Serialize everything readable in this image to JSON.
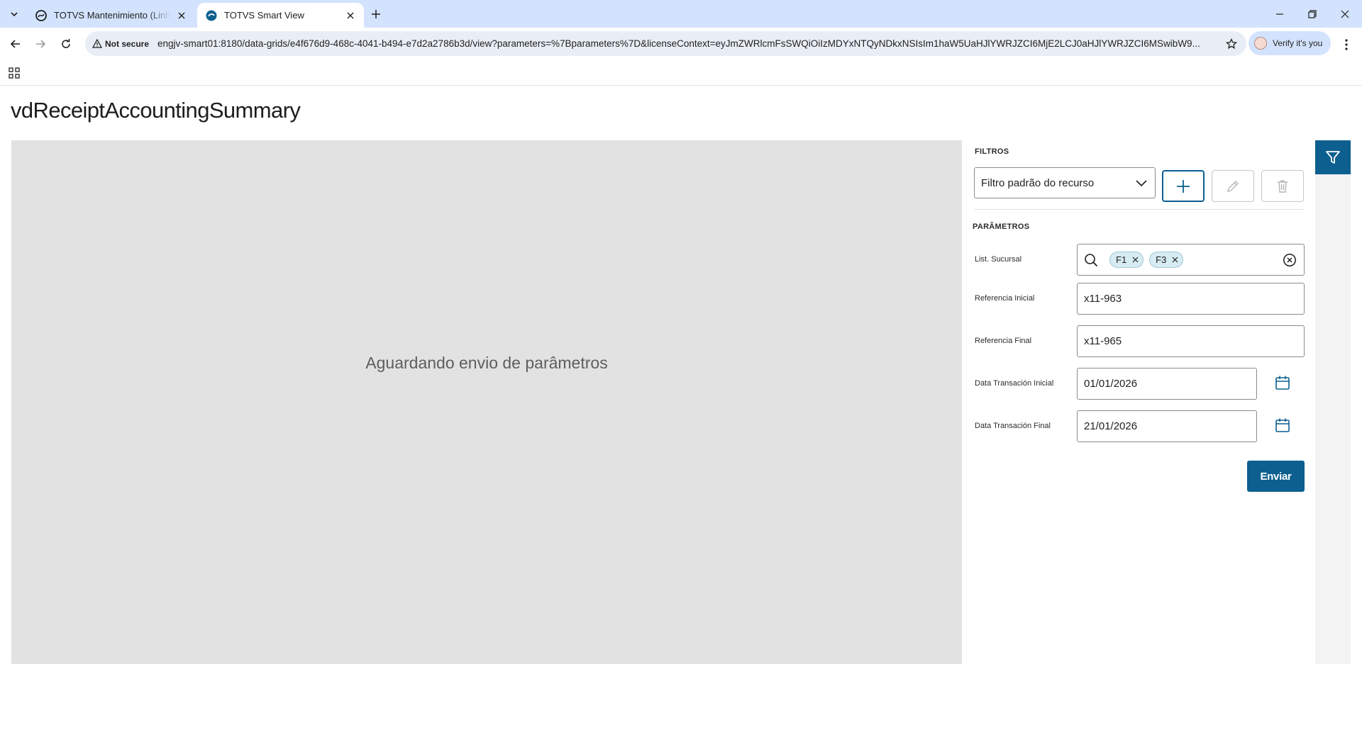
{
  "browser": {
    "tabs": [
      {
        "title": "TOTVS Mantenimiento (Linha D",
        "active": false
      },
      {
        "title": "TOTVS Smart View",
        "active": true
      }
    ],
    "address": {
      "security_label": "Not secure",
      "url": "engjv-smart01:8180/data-grids/e4f676d9-468c-4041-b494-e7d2a2786b3d/view?parameters=%7Bparameters%7D&licenseContext=eyJmZWRlcmFsSWQiOiIzMDYxNTQyNDkxNSIsIm1haW5UaHJlYWRJZCI6MjE2LCJ0aHJlYWRJZCI6MSwibW9..."
    },
    "profile_label": "Verify it's you"
  },
  "page": {
    "title": "vdReceiptAccountingSummary",
    "viewer_message": "Aguardando envio de parâmetros"
  },
  "filters": {
    "section_title": "FILTROS",
    "selected_filter": "Filtro padrão do recurso"
  },
  "parameters": {
    "section_title": "PARÂMETROS",
    "list_sucursal": {
      "label": "List. Sucursal",
      "chips": [
        "F1",
        "F3"
      ]
    },
    "referencia_inicial": {
      "label": "Referencia Inicial",
      "value": "x11-963"
    },
    "referencia_final": {
      "label": "Referencia Final",
      "value": "x11-965"
    },
    "data_inicial": {
      "label": "Data Transación Inicial",
      "value": "01/01/2026"
    },
    "data_final": {
      "label": "Data Transación Final",
      "value": "21/01/2026"
    },
    "submit_label": "Enviar"
  },
  "colors": {
    "brand": "#0c5f8f",
    "tabstrip": "#d3e3fd",
    "viewer_bg": "#e2e2e2"
  }
}
